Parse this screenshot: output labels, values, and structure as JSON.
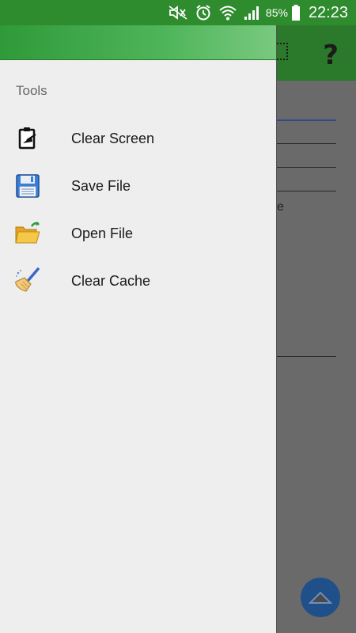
{
  "status_bar": {
    "battery_percent": "85%",
    "time": "22:23",
    "icons": [
      "mute-icon",
      "alarm-icon",
      "wifi-icon",
      "signal-icon",
      "battery-icon"
    ]
  },
  "toolbar": {
    "help_label": "?"
  },
  "drawer": {
    "section_title": "Tools",
    "items": [
      {
        "label": "Clear Screen",
        "icon": "clipboard-clear-icon"
      },
      {
        "label": "Save File",
        "icon": "floppy-disk-icon"
      },
      {
        "label": "Open File",
        "icon": "open-folder-icon"
      },
      {
        "label": "Clear Cache",
        "icon": "broom-icon"
      }
    ]
  },
  "background": {
    "partial_text": "e"
  },
  "colors": {
    "status_bar": "#2e8b2e",
    "toolbar": "#2b7a2b",
    "drawer_bg": "#eeeeee",
    "fab": "#20508a"
  }
}
